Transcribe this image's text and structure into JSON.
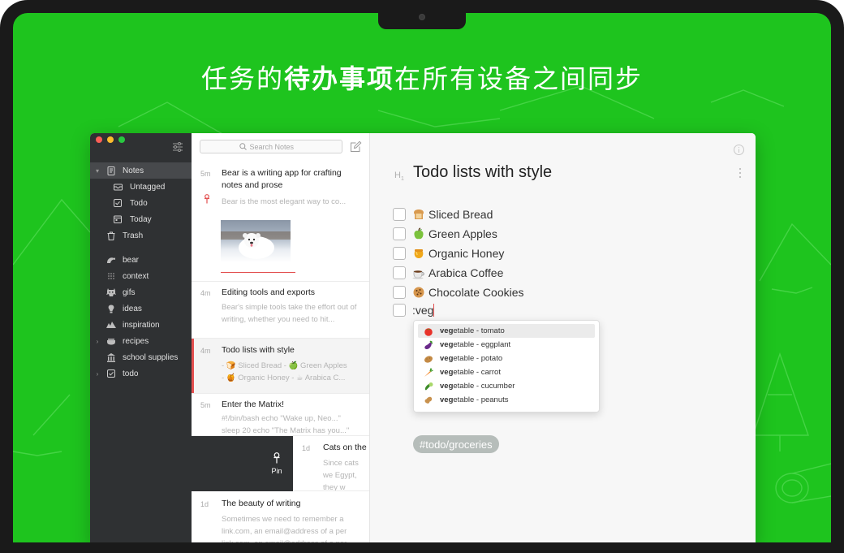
{
  "headline": {
    "part1": "任务的",
    "bold": "待办事项",
    "part2": "在所有设备之间同步"
  },
  "sidebar": {
    "items": [
      {
        "label": "Notes",
        "icon": "notes-icon"
      },
      {
        "label": "Untagged",
        "icon": "untagged-icon"
      },
      {
        "label": "Todo",
        "icon": "todo-icon"
      },
      {
        "label": "Today",
        "icon": "today-icon"
      },
      {
        "label": "Trash",
        "icon": "trash-icon"
      },
      {
        "label": "bear",
        "icon": "bear-tag-icon"
      },
      {
        "label": "context",
        "icon": "context-tag-icon"
      },
      {
        "label": "gifs",
        "icon": "gifs-tag-icon"
      },
      {
        "label": "ideas",
        "icon": "ideas-tag-icon"
      },
      {
        "label": "inspiration",
        "icon": "inspiration-tag-icon"
      },
      {
        "label": "recipes",
        "icon": "recipes-tag-icon"
      },
      {
        "label": "school supplies",
        "icon": "school-supplies-tag-icon"
      },
      {
        "label": "todo",
        "icon": "todo-tag-icon"
      }
    ]
  },
  "notelist": {
    "search_placeholder": "Search Notes",
    "notes": [
      {
        "time": "5m",
        "title": "Bear is a writing app for crafting notes and prose",
        "snippet": "Bear is the most elegant way to co..."
      },
      {
        "time": "4m",
        "title": "Editing tools and exports",
        "snippet": "Bear's simple tools take the effort out of writing, whether you need to hit..."
      },
      {
        "time": "4m",
        "title": "Todo lists with style",
        "snippet_line1": "- 🍞 Sliced Bread - 🍏 Green Apples",
        "snippet_line2": "- 🍯 Organic Honey - ☕ Arabica C..."
      },
      {
        "time": "5m",
        "title": "Enter the Matrix!",
        "snippet": "#!/bin/bash echo \"Wake up, Neo...\" sleep 20 echo \"The Matrix has you...\""
      },
      {
        "time": "1d",
        "title": "Cats on the",
        "snippet": "Since cats we Egypt, they w"
      },
      {
        "time": "1d",
        "title": "The beauty of writing",
        "snippet": "Sometimes we need to remember a link.com, an email@address of a per link.com, an email@address of a per"
      }
    ],
    "pin_label": "Pin"
  },
  "editor": {
    "heading_marker": "H",
    "heading_marker_sub": "1",
    "title": "Todo lists with style",
    "todos": [
      {
        "emoji": "bread-icon",
        "text": "Sliced Bread"
      },
      {
        "emoji": "green-apple-icon",
        "text": "Green Apples"
      },
      {
        "emoji": "honey-pot-icon",
        "text": "Organic Honey"
      },
      {
        "emoji": "coffee-icon",
        "text": "Arabica Coffee"
      },
      {
        "emoji": "cookie-icon",
        "text": "Chocolate Cookies"
      }
    ],
    "typing": ":veg",
    "autocomplete": {
      "query": "veg",
      "items": [
        {
          "emoji": "tomato-icon",
          "rest": "etable - tomato"
        },
        {
          "emoji": "eggplant-icon",
          "rest": "etable - eggplant"
        },
        {
          "emoji": "potato-icon",
          "rest": "etable - potato"
        },
        {
          "emoji": "carrot-icon",
          "rest": "etable - carrot"
        },
        {
          "emoji": "cucumber-icon",
          "rest": "etable - cucumber"
        },
        {
          "emoji": "peanuts-icon",
          "rest": "etable - peanuts"
        }
      ]
    },
    "tag": "#todo/groceries"
  },
  "colors": {
    "background_green": "#1ec41e",
    "accent_red": "#e35050",
    "sidebar_dark": "#2f3133"
  }
}
